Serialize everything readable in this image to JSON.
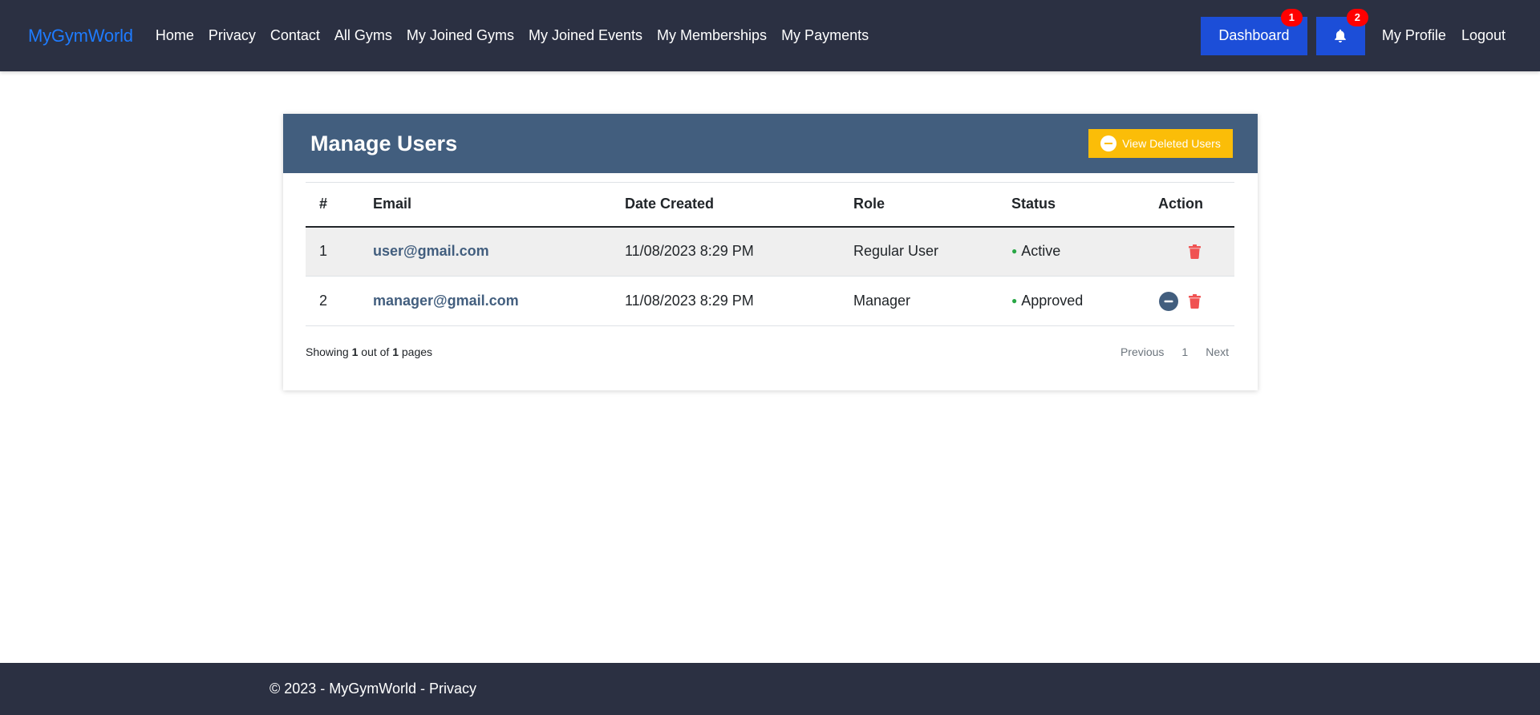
{
  "nav": {
    "brand": "MyGymWorld",
    "links": [
      "Home",
      "Privacy",
      "Contact",
      "All Gyms",
      "My Joined Gyms",
      "My Joined Events",
      "My Memberships",
      "My Payments"
    ],
    "dashboard_label": "Dashboard",
    "dashboard_badge": "1",
    "notifications_badge": "2",
    "profile_label": "My Profile",
    "logout_label": "Logout"
  },
  "card": {
    "title": "Manage Users",
    "deleted_button": "View Deleted Users"
  },
  "table": {
    "headers": [
      "#",
      "Email",
      "Date Created",
      "Role",
      "Status",
      "Action"
    ],
    "rows": [
      {
        "num": "1",
        "email": "user@gmail.com",
        "date": "11/08/2023 8:29 PM",
        "role": "Regular User",
        "status": "Active"
      },
      {
        "num": "2",
        "email": "manager@gmail.com",
        "date": "11/08/2023 8:29 PM",
        "role": "Manager",
        "status": "Approved"
      }
    ]
  },
  "pagination": {
    "showing_prefix": "Showing",
    "current": "1",
    "middle": "out of",
    "total": "1",
    "suffix": "pages",
    "previous": "Previous",
    "page": "1",
    "next": "Next"
  },
  "footer": {
    "copyright": "© 2023 - MyGymWorld - ",
    "privacy": "Privacy"
  },
  "colors": {
    "navbar": "#2b3042",
    "card_header": "#425e7e",
    "accent": "#1c4ed8",
    "warning": "#fbbd08",
    "danger": "#f05252",
    "status_ok": "#28a745"
  }
}
